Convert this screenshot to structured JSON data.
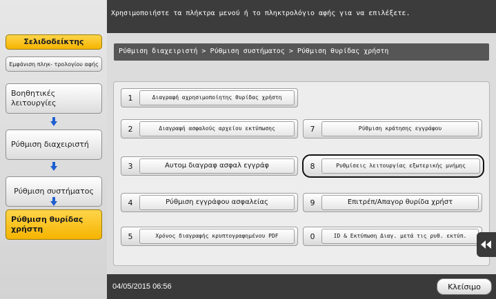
{
  "topbar": {
    "message": "Χρησιμοποιήστε τα πλήκτρα μενού ή το πληκτρολόγιο αφής για να επιλέξετε."
  },
  "sidebar": {
    "bookmark": "Σελιδοδείκτης",
    "keypad_toggle": "Εμφάνιση πληκ- τρολογίου αφής",
    "nav": [
      {
        "label": "Βοηθητικές λειτουργίες"
      },
      {
        "label": "Ρύθμιση διαχειριστή"
      },
      {
        "label": "Ρύθμιση συστήματος"
      },
      {
        "label": "Ρύθμιση θυρίδας χρήστη"
      }
    ]
  },
  "breadcrumb": "Ρύθμιση διαχειριστή > Ρύθμιση συστήματος > Ρύθμιση θυρίδας χρήστη",
  "menu": {
    "left": [
      {
        "num": "1",
        "label": "Διαγραφή αχρησιμοποίητης θυρίδας χρήστη"
      },
      {
        "num": "2",
        "label": "Διαγραφή ασφαλούς αρχείου εκτύπωσης"
      },
      {
        "num": "3",
        "label": "Αυτομ διαγραφ ασφαλ εγγράφ"
      },
      {
        "num": "4",
        "label": "Ρύθμιση εγγράφου ασφαλείας"
      },
      {
        "num": "5",
        "label": "Χρόνος διαγραφής κρυπτογραφημένου PDF"
      }
    ],
    "right": [
      {
        "num": "7",
        "label": "Ρύθμιση κράτησης εγγράφου"
      },
      {
        "num": "8",
        "label": "Ρυθμίσεις λειτουργίας εξωτερικής μνήμης"
      },
      {
        "num": "9",
        "label": "Επιτρέπ/Απαγορ θυρίδα χρήστ"
      },
      {
        "num": "0",
        "label": "ID & Εκτύπωση Διαγ. μετά τις ρυθ. εκτύπ."
      }
    ]
  },
  "footer": {
    "datetime": "04/05/2015  06:56",
    "close_label": "Κλείσιμο"
  },
  "colors": {
    "accent": "#f5b400",
    "arrow": "#1e5fd0",
    "topbar": "#3c3c3c"
  }
}
